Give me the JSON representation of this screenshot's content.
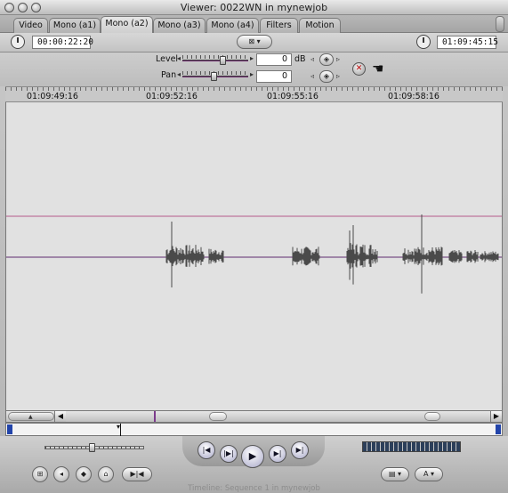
{
  "window": {
    "title": "Viewer: 0022WN in mynewjob"
  },
  "tabs": [
    {
      "label": "Video",
      "active": false
    },
    {
      "label": "Mono (a1)",
      "active": false
    },
    {
      "label": "Mono (a2)",
      "active": true
    },
    {
      "label": "Mono (a3)",
      "active": false
    },
    {
      "label": "Mono (a4)",
      "active": false
    },
    {
      "label": "Filters",
      "active": false
    },
    {
      "label": "Motion",
      "active": false
    }
  ],
  "timecode": {
    "duration": "00:00:22:20",
    "current": "01:09:45:15"
  },
  "audio": {
    "level_label": "Level",
    "level_value": "0",
    "level_unit": "dB",
    "pan_label": "Pan",
    "pan_value": "0"
  },
  "ruler": {
    "labels": [
      "01:09:49:16",
      "01:09:52:16",
      "01:09:55:16",
      "01:09:58:16"
    ]
  },
  "footer": {
    "text": "Timeline: Sequence 1 in mynewjob"
  },
  "icons": {
    "close": "close-icon",
    "minimize": "minimize-icon",
    "zoom": "zoom-icon",
    "clip_clock": "clock-icon",
    "timecode_clock": "clock-icon",
    "reset": "reset-x-icon",
    "pointer": "hand-pointer-icon"
  },
  "colors": {
    "waveform": "#4a4a4a",
    "level_line": "#b55a8a",
    "center_line": "#5e2c6e",
    "marker_blue": "#2244aa"
  }
}
